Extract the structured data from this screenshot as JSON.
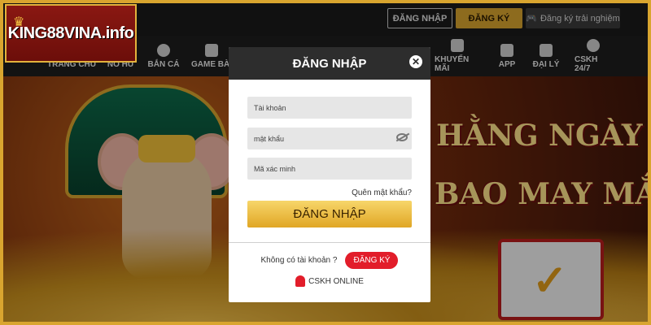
{
  "brand": {
    "logo_text": "KING88VINA.info"
  },
  "header": {
    "login_label": "ĐĂNG NHẬP",
    "register_label": "ĐĂNG KÝ",
    "trial_label": "Đăng ký trải nghiệm"
  },
  "nav": [
    {
      "label": "TRANG CHỦ"
    },
    {
      "label": "NỔ HŨ"
    },
    {
      "label": "BẮN CÁ"
    },
    {
      "label": "GAME BÀI"
    },
    {
      "label": "KHUYẾN MÃI"
    },
    {
      "label": "APP"
    },
    {
      "label": "ĐẠI LÝ"
    },
    {
      "label": "CSKH 24/7"
    }
  ],
  "banner": {
    "line1": "HẰNG NGÀY",
    "line2": "BAO MAY MẮN"
  },
  "modal": {
    "title": "ĐĂNG NHẬP",
    "username_placeholder": "Tài khoản",
    "password_placeholder": "mật khẩu",
    "captcha_placeholder": "Mã xác minh",
    "forgot_label": "Quên mật khẩu?",
    "submit_label": "ĐĂNG NHẬP",
    "no_account_text": "Không có tài khoản ?",
    "register_label": "ĐĂNG KÝ",
    "support_label": "CSKH ONLINE"
  },
  "colors": {
    "gold": "#d9a52f",
    "red": "#e21d2a",
    "dark": "#2d2d2d"
  }
}
